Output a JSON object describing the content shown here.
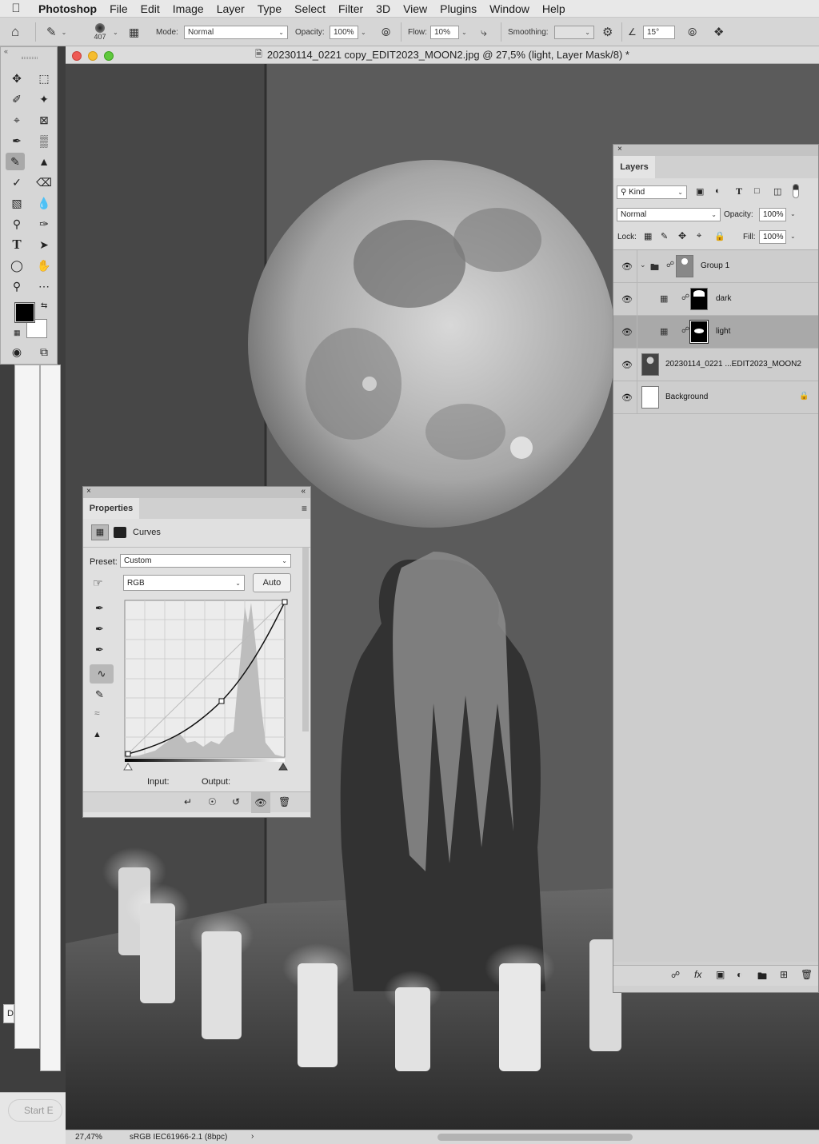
{
  "menubar": {
    "app_name": "Photoshop",
    "items": [
      "File",
      "Edit",
      "Image",
      "Layer",
      "Type",
      "Select",
      "Filter",
      "3D",
      "View",
      "Plugins",
      "Window",
      "Help"
    ]
  },
  "options": {
    "brush_size": "407",
    "mode_label": "Mode:",
    "mode_value": "Normal",
    "opacity_label": "Opacity:",
    "opacity_value": "100%",
    "flow_label": "Flow:",
    "flow_value": "10%",
    "smoothing_label": "Smoothing:",
    "smoothing_value": "",
    "angle_value": "15°"
  },
  "document": {
    "title": "20230114_0221 copy_EDIT2023_MOON2.jpg @ 27,5% (light, Layer Mask/8) *",
    "zoom": "27,47%",
    "color_profile": "sRGB IEC61966-2.1 (8bpc)"
  },
  "background_windows": {
    "partial_text": "D",
    "start_label": "Start E"
  },
  "properties": {
    "tab_label": "Properties",
    "adjustment_name": "Curves",
    "preset_label": "Preset:",
    "preset_value": "Custom",
    "channel_value": "RGB",
    "auto_label": "Auto",
    "input_label": "Input:",
    "output_label": "Output:"
  },
  "layers": {
    "tab_label": "Layers",
    "kind_label": "Kind",
    "blend_mode": "Normal",
    "opacity_label": "Opacity:",
    "opacity_value": "100%",
    "lock_label": "Lock:",
    "fill_label": "Fill:",
    "fill_value": "100%",
    "items": [
      {
        "name": "Group 1"
      },
      {
        "name": "dark"
      },
      {
        "name": "light"
      },
      {
        "name": "20230114_0221 ...EDIT2023_MOON2"
      },
      {
        "name": "Background"
      }
    ]
  },
  "colors": {
    "foreground": "#000000",
    "background": "#ffffff",
    "selected_layer": "#a9a9a9"
  }
}
